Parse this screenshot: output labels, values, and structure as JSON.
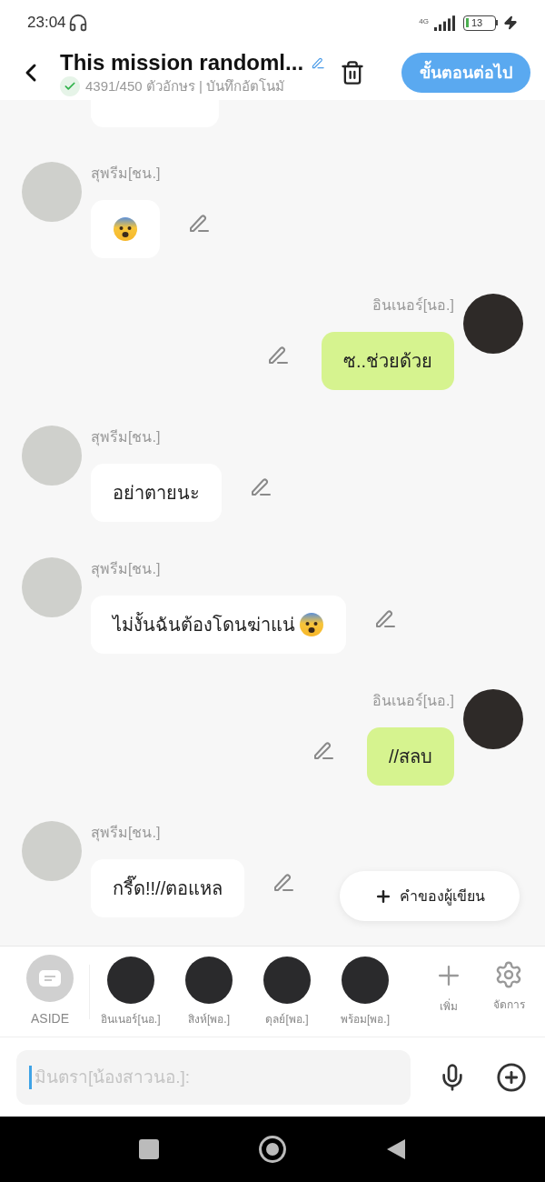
{
  "status_bar": {
    "time": "23:04",
    "network": "4G",
    "battery": "13"
  },
  "header": {
    "title": "This mission randoml...",
    "counter": "4391/450 ตัวอักษร | บันทึกอัตโนมั",
    "next_button": "ขั้นตอนต่อไป"
  },
  "messages": [
    {
      "kind": "cut",
      "outgoing": false
    },
    {
      "kind": "emoji",
      "outgoing": false,
      "name": "สุพรีม[ชน.]"
    },
    {
      "kind": "text",
      "outgoing": true,
      "name": "อินเนอร์[นอ.]",
      "text": "ซ..ช่วยด้วย"
    },
    {
      "kind": "text",
      "outgoing": false,
      "name": "สุพรีม[ชน.]",
      "text": "อย่าตายนะ"
    },
    {
      "kind": "text",
      "outgoing": false,
      "name": "สุพรีม[ชน.]",
      "text": "ไม่งั้นฉันต้องโดนฆ่าแน่",
      "emoji_after": true
    },
    {
      "kind": "text",
      "outgoing": true,
      "name": "อินเนอร์[นอ.]",
      "text": "//สลบ"
    },
    {
      "kind": "text",
      "outgoing": false,
      "name": "สุพรีม[ชน.]",
      "text": "กรี๊ด!!//ตอแหล"
    }
  ],
  "author_note_button": "คำของผู้เขียน",
  "characters": [
    {
      "kind": "aside",
      "name": "ASIDE"
    },
    {
      "kind": "character",
      "name": "อินเนอร์[นอ.]"
    },
    {
      "kind": "character",
      "name": "สิงห์[พอ.]"
    },
    {
      "kind": "character",
      "name": "ดุลย์[พอ.]"
    },
    {
      "kind": "character",
      "name": "พร้อม[พอ.]"
    }
  ],
  "actions": [
    {
      "kind": "add",
      "label": "เพิ่ม"
    },
    {
      "kind": "manage",
      "label": "จัดการ"
    }
  ],
  "composer": {
    "placeholder": "มินตรา[น้องสาวนอ.]:"
  }
}
